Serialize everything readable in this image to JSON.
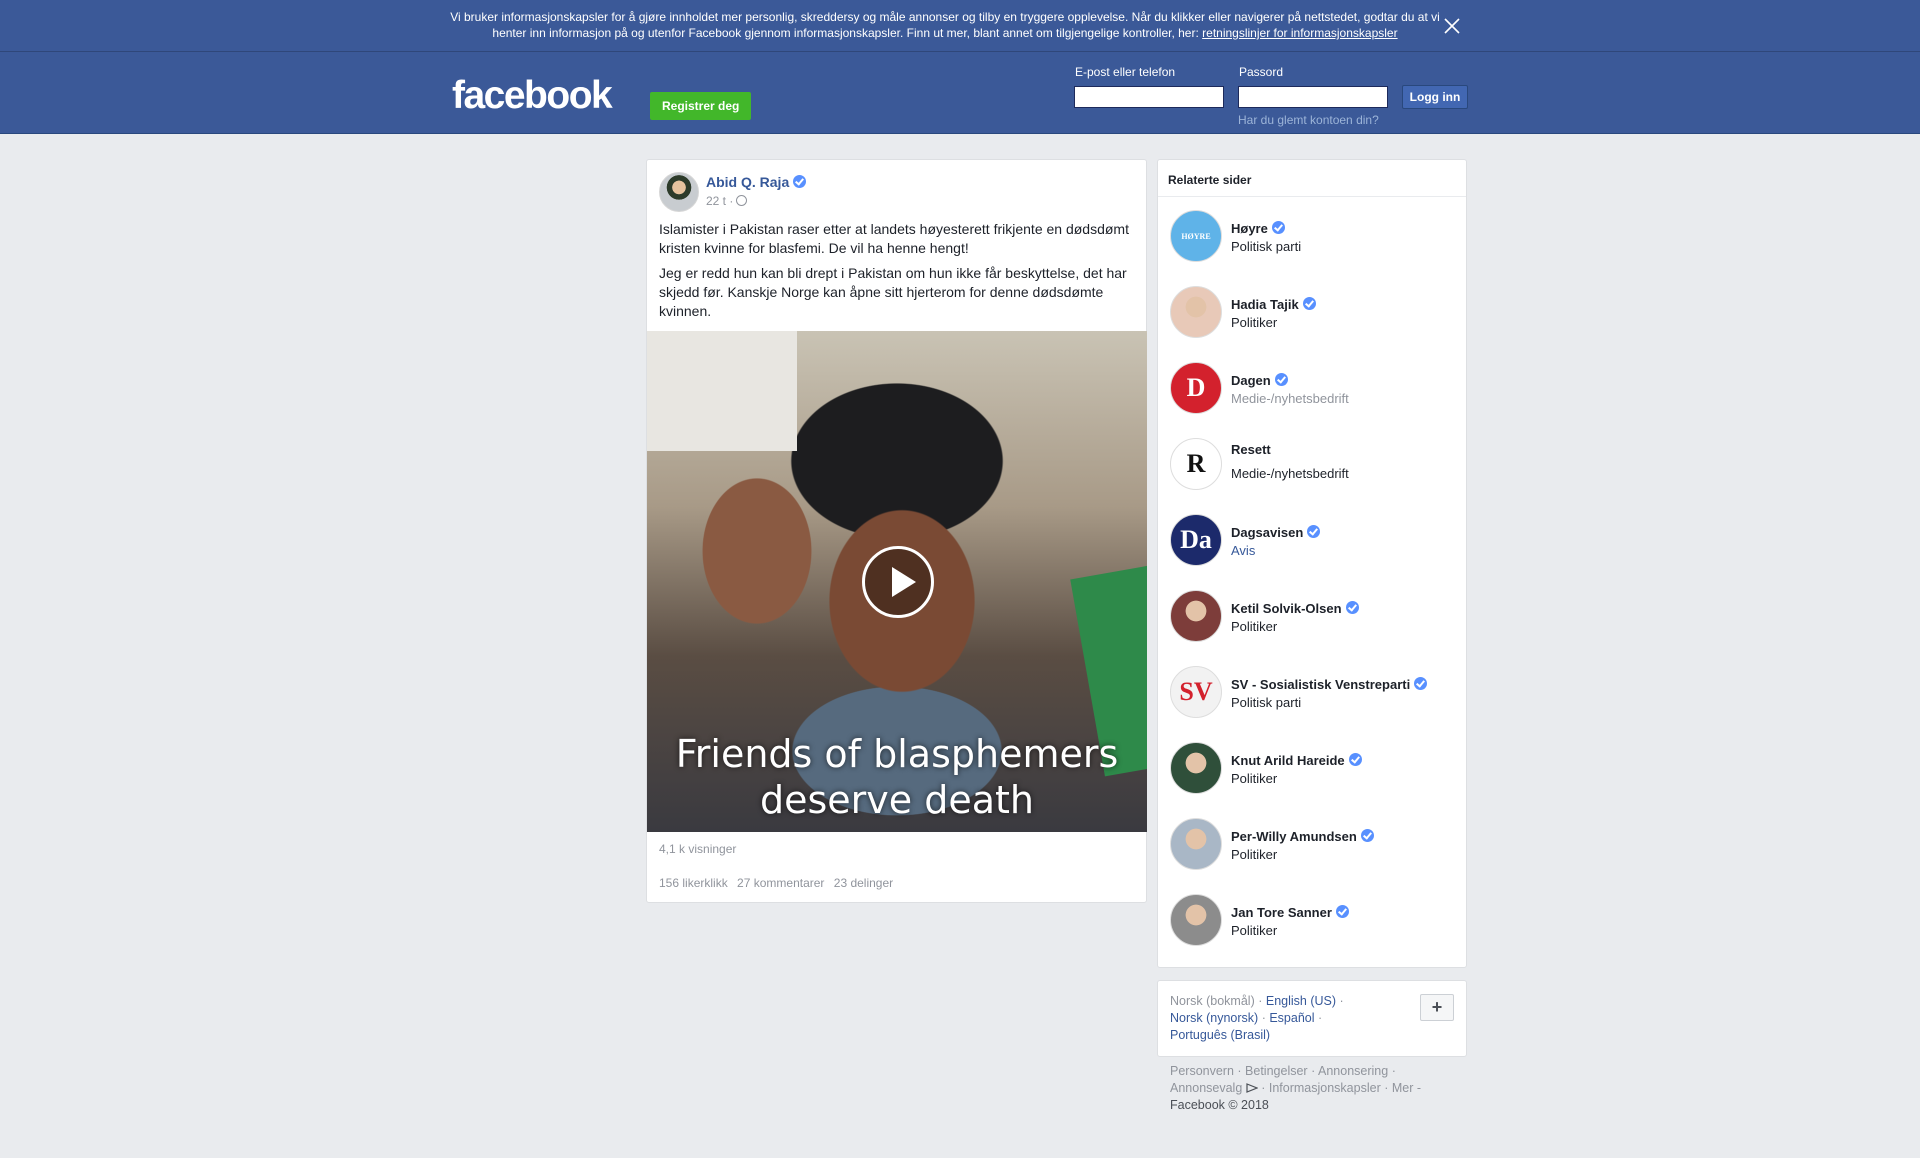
{
  "cookie_banner": {
    "text": "Vi bruker informasjonskapsler for å gjøre innholdet mer personlig, skreddersy og måle annonser og tilby en tryggere opplevelse. Når du klikker eller navigerer på nettstedet, godtar du at vi henter inn informasjon på og utenfor Facebook gjennom informasjonskapsler. Finn ut mer, blant annet om tilgjengelige kontroller, her: ",
    "link": "retningslinjer for informasjonskapsler"
  },
  "header": {
    "logo": "facebook",
    "register_label": "Registrer deg",
    "email_label": "E-post eller telefon",
    "password_label": "Passord",
    "email_value": "",
    "password_value": "",
    "login_label": "Logg inn",
    "forgot_label": "Har du glemt kontoen din?"
  },
  "post": {
    "author": "Abid Q. Raja",
    "time": "22 t ·",
    "paragraphs": [
      "Islamister i Pakistan raser etter at landets høyesterett frikjente en dødsdømt kristen kvinne for blasfemi. De vil ha henne hengt!",
      "Jeg er redd hun kan bli drept i Pakistan om hun ikke får beskyttelse, det har skjedd før. Kanskje Norge kan åpne sitt hjerterom for denne dødsdømte kvinnen."
    ],
    "video_caption_line1": "Friends of blasphemers",
    "video_caption_line2": "deserve death",
    "views": "4,1 k visninger",
    "likes": "156 likerklikk",
    "comments": "27 kommentarer",
    "shares": "23 delinger"
  },
  "related": {
    "title": "Relaterte sider",
    "items": [
      {
        "name": "Høyre",
        "category": "Politisk parti",
        "verified": true,
        "pic_color": "#5fb3e8",
        "pic_text": "HØYRE"
      },
      {
        "name": "Hadia Tajik",
        "category": "Politiker",
        "verified": true,
        "pic_color": "#e8c9b8",
        "pic_text": ""
      },
      {
        "name": "Dagen",
        "category": "Medie-/nyhetsbedrift",
        "verified": true,
        "pic_color": "#d3212d",
        "pic_text": "D"
      },
      {
        "name": "Resett",
        "category": "Medie-/nyhetsbedrift",
        "verified": false,
        "pic_color": "#ffffff",
        "pic_text": "R"
      },
      {
        "name": "Dagsavisen",
        "category": "Avis",
        "verified": true,
        "pic_color": "#1c2a6b",
        "pic_text": "Da"
      },
      {
        "name": "Ketil Solvik-Olsen",
        "category": "Politiker",
        "verified": true,
        "pic_color": "#7d3d3a",
        "pic_text": ""
      },
      {
        "name": "SV - Sosialistisk Venstreparti",
        "category": "Politisk parti",
        "verified": true,
        "pic_color": "#f2f2f2",
        "pic_text": "SV"
      },
      {
        "name": "Knut Arild Hareide",
        "category": "Politiker",
        "verified": true,
        "pic_color": "#2f4f3a",
        "pic_text": ""
      },
      {
        "name": "Per-Willy Amundsen",
        "category": "Politiker",
        "verified": true,
        "pic_color": "#a9b7c6",
        "pic_text": ""
      },
      {
        "name": "Jan Tore Sanner",
        "category": "Politiker",
        "verified": true,
        "pic_color": "#8c8c8c",
        "pic_text": ""
      }
    ]
  },
  "languages": {
    "current": "Norsk (bokmål)",
    "others": [
      "English (US)",
      "Norsk (nynorsk)",
      "Español",
      "Português (Brasil)"
    ],
    "plus": "+"
  },
  "footer": {
    "links": [
      "Personvern",
      "Betingelser",
      "Annonsering",
      "Annonsevalg",
      "Informasjonskapsler",
      "Mer"
    ],
    "copyright": "Facebook © 2018"
  }
}
